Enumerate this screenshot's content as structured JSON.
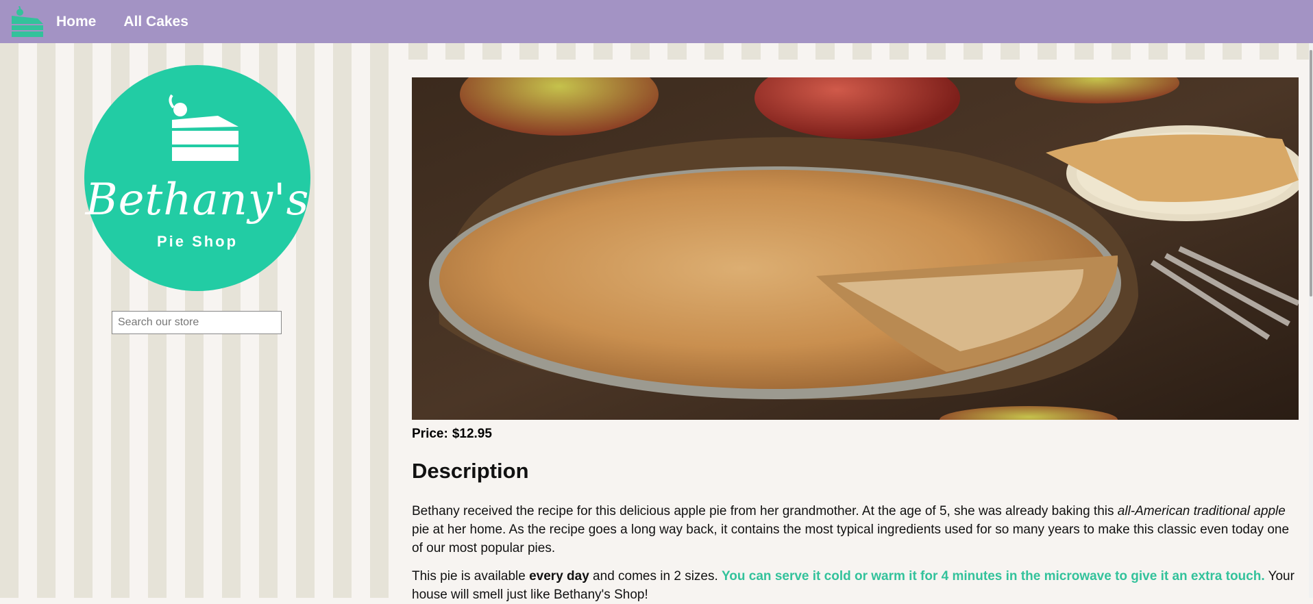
{
  "nav": {
    "logo_icon": "cake-icon",
    "home": "Home",
    "all_cakes": "All Cakes",
    "bar_color": "#a393c4"
  },
  "sidebar": {
    "logo_title": "Bethany's",
    "logo_subtitle": "Pie Shop",
    "search_placeholder": "Search our store",
    "logo_color": "#22cca4"
  },
  "product": {
    "image_description": "apple pie",
    "price_label": "Price:",
    "price": "$12.95",
    "description_heading": "Description",
    "paragraph1": {
      "part1": "Bethany received the recipe for this delicious apple pie from her grandmother. At the age of 5, she was already baking this ",
      "italic": "all-American traditional apple",
      "part2": " pie at her home. As the recipe goes a long way back, it contains the most typical ingredients used for so many years to make this classic even today one of our most popular pies."
    },
    "paragraph2": {
      "part1": "This pie is available ",
      "bold": "every day",
      "part2": " and comes in 2 sizes. ",
      "highlight": "You can serve it cold or warm it for 4 minutes in the microwave to give it an extra touch.",
      "part3": " Your house will smell just like Bethany's Shop!"
    },
    "accent_color": "#33c29b"
  }
}
